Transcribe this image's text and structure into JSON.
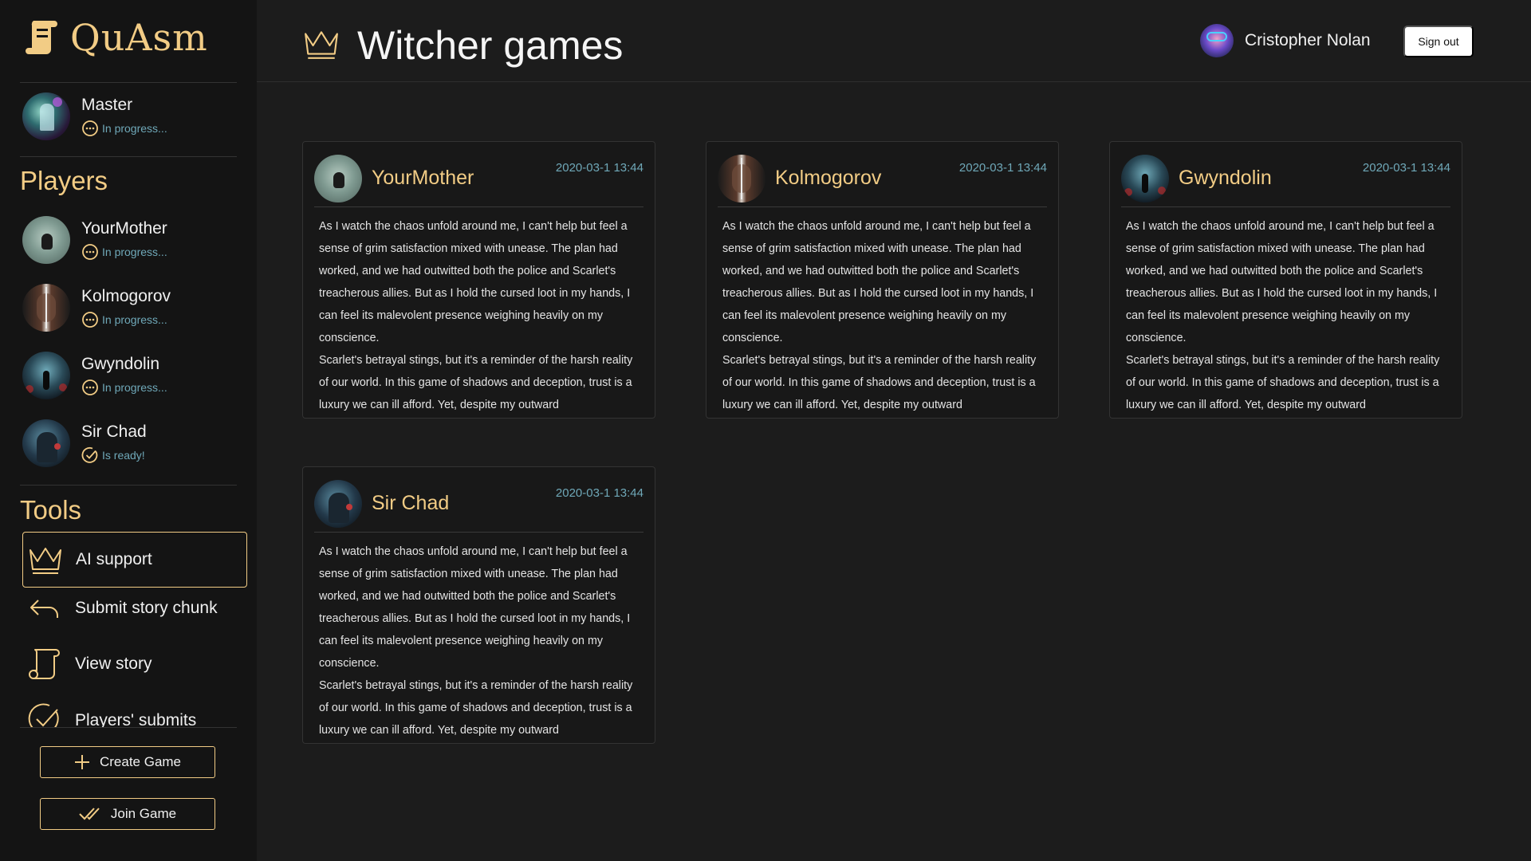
{
  "app": {
    "logo_text": "QuAsm"
  },
  "master": {
    "name": "Master",
    "status": "In progress..."
  },
  "players_title": "Players",
  "players": [
    {
      "name": "YourMother",
      "status": "In progress..."
    },
    {
      "name": "Kolmogorov",
      "status": "In progress..."
    },
    {
      "name": "Gwyndolin",
      "status": "In progress..."
    },
    {
      "name": "Sir Chad",
      "status": "Is ready!"
    }
  ],
  "tools_title": "Tools",
  "tools": [
    {
      "label": "AI support",
      "icon": "crown-icon"
    },
    {
      "label": "Submit story chunk",
      "icon": "reply-arrow-icon"
    },
    {
      "label": "View story",
      "icon": "scroll-icon"
    },
    {
      "label": "Players' submits",
      "icon": "check-circle-icon"
    }
  ],
  "buttons": {
    "create_game": "Create Game",
    "join_game": "Join Game"
  },
  "header": {
    "title": "Witcher games",
    "user_name": "Cristopher Nolan",
    "sign_out": "Sign out"
  },
  "cards": [
    {
      "name": "YourMother",
      "time": "2020-03-1 13:44",
      "p1": "As I watch the chaos unfold around me, I can't help but feel a sense of grim satisfaction mixed with unease. The plan had worked, and we had outwitted both the police and Scarlet's treacherous allies. But as I hold the cursed loot in my hands, I can feel its malevolent presence weighing heavily on my conscience.",
      "p2": "Scarlet's betrayal stings, but it's a reminder of the harsh reality of our world. In this game of shadows and deception, trust is a luxury we can ill afford. Yet, despite my outward"
    },
    {
      "name": "Kolmogorov",
      "time": "2020-03-1 13:44",
      "p1": "As I watch the chaos unfold around me, I can't help but feel a sense of grim satisfaction mixed with unease. The plan had worked, and we had outwitted both the police and Scarlet's treacherous allies. But as I hold the cursed loot in my hands, I can feel its malevolent presence weighing heavily on my conscience.",
      "p2": "Scarlet's betrayal stings, but it's a reminder of the harsh reality of our world. In this game of shadows and deception, trust is a luxury we can ill afford. Yet, despite my outward"
    },
    {
      "name": "Gwyndolin",
      "time": "2020-03-1 13:44",
      "p1": "As I watch the chaos unfold around me, I can't help but feel a sense of grim satisfaction mixed with unease. The plan had worked, and we had outwitted both the police and Scarlet's treacherous allies. But as I hold the cursed loot in my hands, I can feel its malevolent presence weighing heavily on my conscience.",
      "p2": "Scarlet's betrayal stings, but it's a reminder of the harsh reality of our world. In this game of shadows and deception, trust is a luxury we can ill afford. Yet, despite my outward"
    },
    {
      "name": "Sir Chad",
      "time": "2020-03-1 13:44",
      "p1": "As I watch the chaos unfold around me, I can't help but feel a sense of grim satisfaction mixed with unease. The plan had worked, and we had outwitted both the police and Scarlet's treacherous allies. But as I hold the cursed loot in my hands, I can feel its malevolent presence weighing heavily on my conscience.",
      "p2": "Scarlet's betrayal stings, but it's a reminder of the harsh reality of our world. In this game of shadows and deception, trust is a luxury we can ill afford. Yet, despite my outward"
    }
  ],
  "colors": {
    "accent": "#f2cc85",
    "status": "#6fa8b8",
    "background": "#1c1c1c",
    "sidebar": "#141414"
  }
}
